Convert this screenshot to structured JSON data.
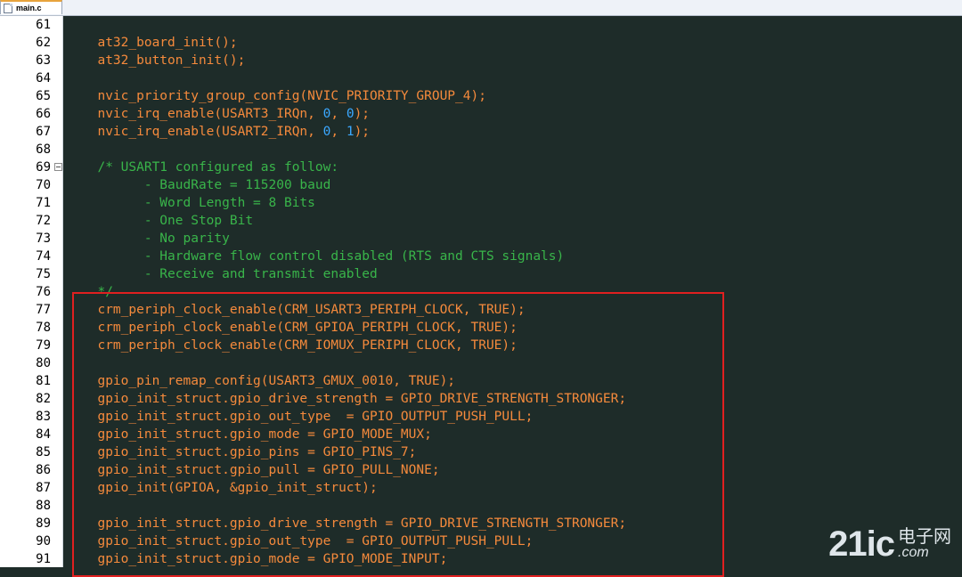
{
  "tab": {
    "label": "main.c",
    "icon": "file-icon"
  },
  "lines": [
    {
      "num": "61",
      "tokens": []
    },
    {
      "num": "62",
      "tokens": [
        {
          "t": "  at32_board_init();",
          "k": "code"
        }
      ]
    },
    {
      "num": "63",
      "tokens": [
        {
          "t": "  at32_button_init();",
          "k": "code"
        }
      ]
    },
    {
      "num": "64",
      "tokens": []
    },
    {
      "num": "65",
      "tokens": [
        {
          "t": "  nvic_priority_group_config(NVIC_PRIORITY_GROUP_4);",
          "k": "code"
        }
      ]
    },
    {
      "num": "66",
      "tokens": [
        {
          "t": "  nvic_irq_enable(USART3_IRQn, ",
          "k": "code"
        },
        {
          "t": "0",
          "k": "num"
        },
        {
          "t": ", ",
          "k": "code"
        },
        {
          "t": "0",
          "k": "num"
        },
        {
          "t": ");",
          "k": "code"
        }
      ]
    },
    {
      "num": "67",
      "tokens": [
        {
          "t": "  nvic_irq_enable(USART2_IRQn, ",
          "k": "code"
        },
        {
          "t": "0",
          "k": "num"
        },
        {
          "t": ", ",
          "k": "code"
        },
        {
          "t": "1",
          "k": "num"
        },
        {
          "t": ");",
          "k": "code"
        }
      ]
    },
    {
      "num": "68",
      "tokens": []
    },
    {
      "num": "69",
      "fold": true,
      "tokens": [
        {
          "t": "  /* USART1 configured as follow:",
          "k": "comment"
        }
      ]
    },
    {
      "num": "70",
      "tokens": [
        {
          "t": "        - BaudRate = 115200 baud",
          "k": "comment"
        }
      ]
    },
    {
      "num": "71",
      "tokens": [
        {
          "t": "        - Word Length = 8 Bits",
          "k": "comment"
        }
      ]
    },
    {
      "num": "72",
      "tokens": [
        {
          "t": "        - One Stop Bit",
          "k": "comment"
        }
      ]
    },
    {
      "num": "73",
      "tokens": [
        {
          "t": "        - No parity",
          "k": "comment"
        }
      ]
    },
    {
      "num": "74",
      "tokens": [
        {
          "t": "        - Hardware flow control disabled (RTS and CTS signals)",
          "k": "comment"
        }
      ]
    },
    {
      "num": "75",
      "tokens": [
        {
          "t": "        - Receive and transmit enabled",
          "k": "comment"
        }
      ]
    },
    {
      "num": "76",
      "tokens": [
        {
          "t": "  */",
          "k": "comment"
        }
      ]
    },
    {
      "num": "77",
      "tokens": [
        {
          "t": "  crm_periph_clock_enable(CRM_USART3_PERIPH_CLOCK, TRUE);",
          "k": "code"
        }
      ]
    },
    {
      "num": "78",
      "tokens": [
        {
          "t": "  crm_periph_clock_enable(CRM_GPIOA_PERIPH_CLOCK, TRUE);",
          "k": "code"
        }
      ]
    },
    {
      "num": "79",
      "tokens": [
        {
          "t": "  crm_periph_clock_enable(CRM_IOMUX_PERIPH_CLOCK, TRUE);",
          "k": "code"
        }
      ]
    },
    {
      "num": "80",
      "tokens": []
    },
    {
      "num": "81",
      "tokens": [
        {
          "t": "  gpio_pin_remap_config(USART3_GMUX_0010, TRUE);",
          "k": "code"
        }
      ]
    },
    {
      "num": "82",
      "tokens": [
        {
          "t": "  gpio_init_struct.gpio_drive_strength = GPIO_DRIVE_STRENGTH_STRONGER;",
          "k": "code"
        }
      ]
    },
    {
      "num": "83",
      "tokens": [
        {
          "t": "  gpio_init_struct.gpio_out_type  = GPIO_OUTPUT_PUSH_PULL;",
          "k": "code"
        }
      ]
    },
    {
      "num": "84",
      "tokens": [
        {
          "t": "  gpio_init_struct.gpio_mode = GPIO_MODE_MUX;",
          "k": "code"
        }
      ]
    },
    {
      "num": "85",
      "tokens": [
        {
          "t": "  gpio_init_struct.gpio_pins = GPIO_PINS_7;",
          "k": "code"
        }
      ]
    },
    {
      "num": "86",
      "tokens": [
        {
          "t": "  gpio_init_struct.gpio_pull = GPIO_PULL_NONE;",
          "k": "code"
        }
      ]
    },
    {
      "num": "87",
      "tokens": [
        {
          "t": "  gpio_init(GPIOA, &gpio_init_struct);",
          "k": "code"
        }
      ]
    },
    {
      "num": "88",
      "tokens": []
    },
    {
      "num": "89",
      "tokens": [
        {
          "t": "  gpio_init_struct.gpio_drive_strength = GPIO_DRIVE_STRENGTH_STRONGER;",
          "k": "code"
        }
      ]
    },
    {
      "num": "90",
      "tokens": [
        {
          "t": "  gpio_init_struct.gpio_out_type  = GPIO_OUTPUT_PUSH_PULL;",
          "k": "code"
        }
      ]
    },
    {
      "num": "91",
      "tokens": [
        {
          "t": "  gpio_init_struct.gpio_mode = GPIO_MODE_INPUT;",
          "k": "code"
        }
      ]
    }
  ],
  "watermark": {
    "main": "21ic",
    "cn": "电子网",
    "dot": ".com"
  },
  "colors": {
    "code": "#f58a3c",
    "comment": "#39b54a",
    "number": "#3ba8ff",
    "background": "#1e2c29",
    "highlight": "#e02020"
  }
}
